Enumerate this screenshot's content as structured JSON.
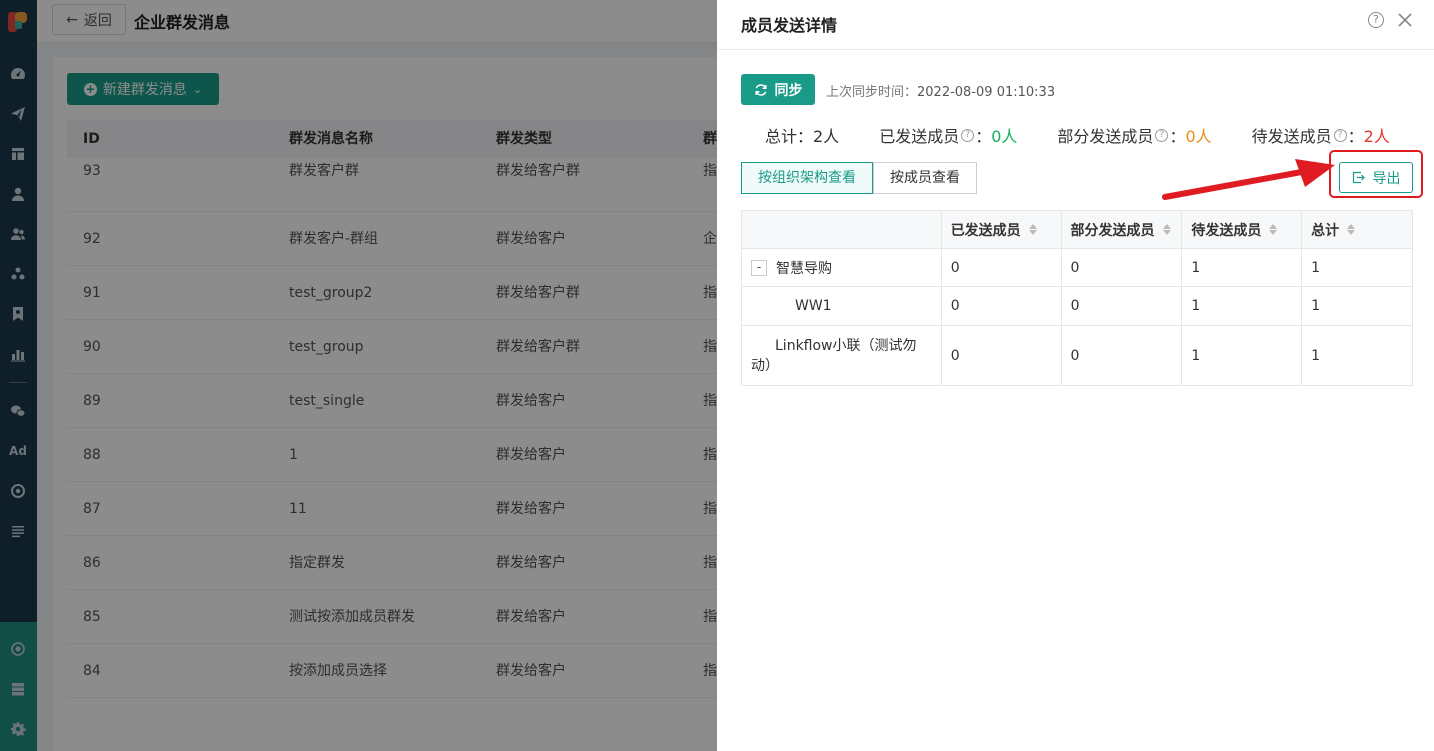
{
  "header": {
    "back_label": "返回",
    "page_title": "企业群发消息"
  },
  "toolbar": {
    "new_button_label": "新建群发消息"
  },
  "list_table": {
    "columns": [
      "ID",
      "群发消息名称",
      "群发类型",
      "群"
    ],
    "rows": [
      {
        "id": "93",
        "name": "群发客户群",
        "type": "群发给客户群",
        "extra": "指"
      },
      {
        "id": "92",
        "name": "群发客户-群组",
        "type": "群发给客户",
        "extra": "企"
      },
      {
        "id": "91",
        "name": "test_group2",
        "type": "群发给客户群",
        "extra": "指"
      },
      {
        "id": "90",
        "name": "test_group",
        "type": "群发给客户群",
        "extra": "指"
      },
      {
        "id": "89",
        "name": "test_single",
        "type": "群发给客户",
        "extra": "指"
      },
      {
        "id": "88",
        "name": "1",
        "type": "群发给客户",
        "extra": "指"
      },
      {
        "id": "87",
        "name": "11",
        "type": "群发给客户",
        "extra": "指"
      },
      {
        "id": "86",
        "name": "指定群发",
        "type": "群发给客户",
        "extra": "指"
      },
      {
        "id": "85",
        "name": "测试按添加成员群发",
        "type": "群发给客户",
        "extra": "指"
      },
      {
        "id": "84",
        "name": "按添加成员选择",
        "type": "群发给客户",
        "extra": "指"
      }
    ]
  },
  "drawer": {
    "title": "成员发送详情",
    "help_glyph": "?",
    "sync_label": "同步",
    "sync_time_label": "上次同步时间：",
    "sync_time_value": "2022-08-09 01:10:33",
    "stats": {
      "total_label": "总计：",
      "total_value": "2人",
      "sent_label": "已发送成员",
      "sent_value": "0人",
      "partial_label": "部分发送成员",
      "partial_value": "0人",
      "pending_label": "待发送成员",
      "pending_value": "2人",
      "colon": "：",
      "help_glyph": "?"
    },
    "view_by_org_label": "按组织架构查看",
    "view_by_member_label": "按成员查看",
    "export_label": "导出",
    "highlight_color": "#e01c23",
    "accent_color": "#1a9b8a",
    "table": {
      "headers": [
        "",
        "已发送成员",
        "部分发送成员",
        "待发送成员",
        "总计"
      ],
      "rows": [
        {
          "toggle": "-",
          "name": "智慧导购",
          "sent": "0",
          "partial": "0",
          "pending": "1",
          "total": "1"
        },
        {
          "name": "WW1",
          "sent": "0",
          "partial": "0",
          "pending": "1",
          "total": "1"
        },
        {
          "name": "Linkflow小联（测试勿动）",
          "sent": "0",
          "partial": "0",
          "pending": "1",
          "total": "1"
        }
      ]
    }
  },
  "icons": {
    "nav": [
      "dashboard-icon",
      "send-icon",
      "layout-icon",
      "user-icon",
      "users-icon",
      "group-icon",
      "bookmark-icon",
      "bar-chart-icon",
      "wechat-icon",
      "ad-icon",
      "target-icon",
      "list-icon",
      "network-icon",
      "server-icon",
      "gear-icon"
    ],
    "nav_ad_text": "Ad"
  }
}
